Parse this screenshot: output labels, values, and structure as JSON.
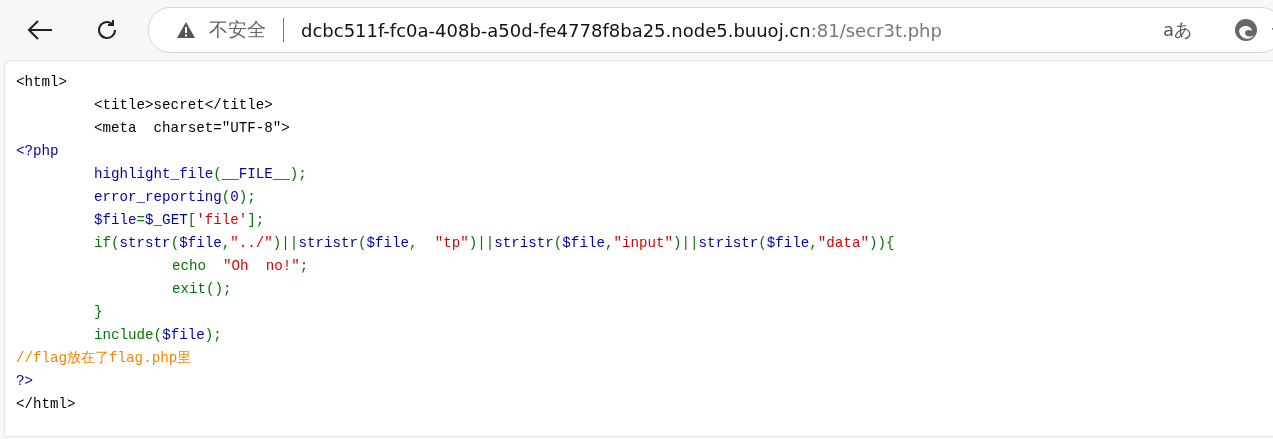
{
  "toolbar": {
    "security_label": "不安全",
    "url_host": "dcbc511f-fc0a-408b-a50d-fe4778f8ba25.node5.buuoj.cn",
    "url_rest": ":81/secr3t.php",
    "translate_glyph": "aあ"
  },
  "code_lines": [
    {
      "color": "#000000",
      "tokens": [
        {
          "text": "<html>"
        }
      ]
    },
    {
      "color": "#000000",
      "tokens": [
        {
          "text": "\t<title>secret</title>"
        }
      ]
    },
    {
      "color": "#000000",
      "tokens": [
        {
          "text": "\t<meta  charset=\"UTF-8\">"
        }
      ]
    },
    {
      "color": "#0000bb",
      "tokens": [
        {
          "text": "<?php"
        }
      ]
    },
    {
      "color": "#007700",
      "tokens": [
        {
          "text": "\thighlight_file",
          "color": "#0000bb"
        },
        {
          "text": "("
        },
        {
          "text": "__FILE__",
          "color": "#0000bb"
        },
        {
          "text": ");"
        }
      ]
    },
    {
      "color": "#007700",
      "tokens": [
        {
          "text": "\terror_reporting",
          "color": "#0000bb"
        },
        {
          "text": "("
        },
        {
          "text": "0",
          "color": "#0000bb"
        },
        {
          "text": ");"
        }
      ]
    },
    {
      "color": "#007700",
      "tokens": [
        {
          "text": "\t$file",
          "color": "#0000bb"
        },
        {
          "text": "="
        },
        {
          "text": "$_GET",
          "color": "#0000bb"
        },
        {
          "text": "["
        },
        {
          "text": "'file'",
          "color": "#dd0000"
        },
        {
          "text": "];"
        }
      ]
    },
    {
      "color": "#007700",
      "tokens": [
        {
          "text": "\tif("
        },
        {
          "text": "strstr",
          "color": "#0000bb"
        },
        {
          "text": "("
        },
        {
          "text": "$file",
          "color": "#0000bb"
        },
        {
          "text": ","
        },
        {
          "text": "\"../\"",
          "color": "#dd0000"
        },
        {
          "text": ")||"
        },
        {
          "text": "stristr",
          "color": "#0000bb"
        },
        {
          "text": "("
        },
        {
          "text": "$file",
          "color": "#0000bb"
        },
        {
          "text": ",  "
        },
        {
          "text": "\"tp\"",
          "color": "#dd0000"
        },
        {
          "text": ")||"
        },
        {
          "text": "stristr",
          "color": "#0000bb"
        },
        {
          "text": "("
        },
        {
          "text": "$file",
          "color": "#0000bb"
        },
        {
          "text": ","
        },
        {
          "text": "\"input\"",
          "color": "#dd0000"
        },
        {
          "text": ")||"
        },
        {
          "text": "stristr",
          "color": "#0000bb"
        },
        {
          "text": "("
        },
        {
          "text": "$file",
          "color": "#0000bb"
        },
        {
          "text": ","
        },
        {
          "text": "\"data\"",
          "color": "#dd0000"
        },
        {
          "text": ")){"
        }
      ]
    },
    {
      "color": "#007700",
      "tokens": [
        {
          "text": "\t\techo  "
        },
        {
          "text": "\"Oh  no!\"",
          "color": "#dd0000"
        },
        {
          "text": ";"
        }
      ]
    },
    {
      "color": "#007700",
      "tokens": [
        {
          "text": "\t\texit();"
        }
      ]
    },
    {
      "color": "#007700",
      "tokens": [
        {
          "text": "\t}"
        }
      ]
    },
    {
      "color": "#007700",
      "tokens": [
        {
          "text": "\tinclude("
        },
        {
          "text": "$file",
          "color": "#0000bb"
        },
        {
          "text": ");"
        }
      ]
    },
    {
      "color": "#ff8000",
      "tokens": [
        {
          "text": "//flag放在了flag.php里"
        }
      ]
    },
    {
      "color": "#0000bb",
      "tokens": [
        {
          "text": "?>"
        }
      ]
    },
    {
      "color": "#000000",
      "tokens": [
        {
          "text": "</html>"
        }
      ]
    }
  ]
}
